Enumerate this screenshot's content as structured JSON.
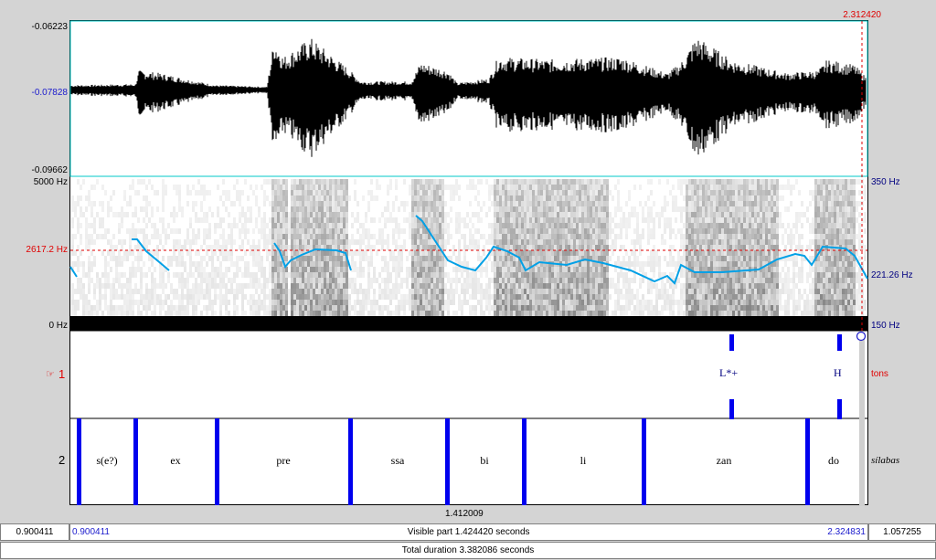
{
  "cursor": {
    "time_label": "2.312420"
  },
  "waveform": {
    "top_label": "-0.06223",
    "mid_label": "-0.07828",
    "bottom_label": "-0.09662"
  },
  "spectrogram": {
    "top_freq_label": "5000 Hz",
    "bottom_freq_label": "0 Hz",
    "cursor_freq_label": "2617.2 Hz",
    "pitch_top_label": "350 Hz",
    "pitch_mid_label": "221.26 Hz",
    "pitch_bottom_label": "150 Hz"
  },
  "tiers": [
    {
      "number": "1",
      "name": "tons",
      "points": [
        {
          "label": "L*+"
        },
        {
          "label": "H"
        }
      ]
    },
    {
      "number": "2",
      "name": "sílabas",
      "intervals": [
        {
          "label": "s(e?)"
        },
        {
          "label": "ex"
        },
        {
          "label": "pre"
        },
        {
          "label": "ssa"
        },
        {
          "label": "bi"
        },
        {
          "label": "li"
        },
        {
          "label": "zan"
        },
        {
          "label": "do"
        },
        {
          "label": ""
        }
      ]
    }
  ],
  "selection": {
    "boundary_time_label": "1.412009"
  },
  "time_bar": {
    "left_outside": "0.900411",
    "visible_start": "0.900411",
    "visible_part": "Visible part 1.424420 seconds",
    "visible_end": "2.324831",
    "right_outside": "1.057255",
    "total_duration": "Total duration 3.382086 seconds"
  },
  "colors": {
    "cursor": "#e00000",
    "pitch": "#00a0e6",
    "boundary": "#0000ee",
    "label_blue": "#1a1acc"
  }
}
